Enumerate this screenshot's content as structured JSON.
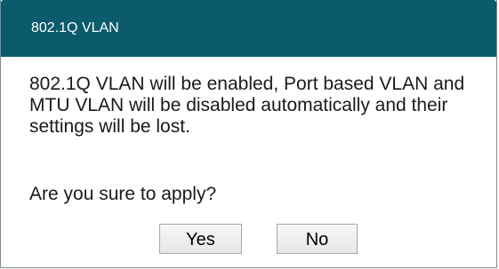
{
  "dialog": {
    "title": "802.1Q VLAN",
    "message": "802.1Q VLAN will be enabled, Port based VLAN and MTU VLAN will be disabled automatically and their settings will be lost.",
    "question": "Are you sure to apply?",
    "yes_label": "Yes",
    "no_label": "No"
  },
  "colors": {
    "titlebar": "#0b5b6c",
    "title_text": "#ffffff",
    "body_text": "#1a1a1a"
  }
}
